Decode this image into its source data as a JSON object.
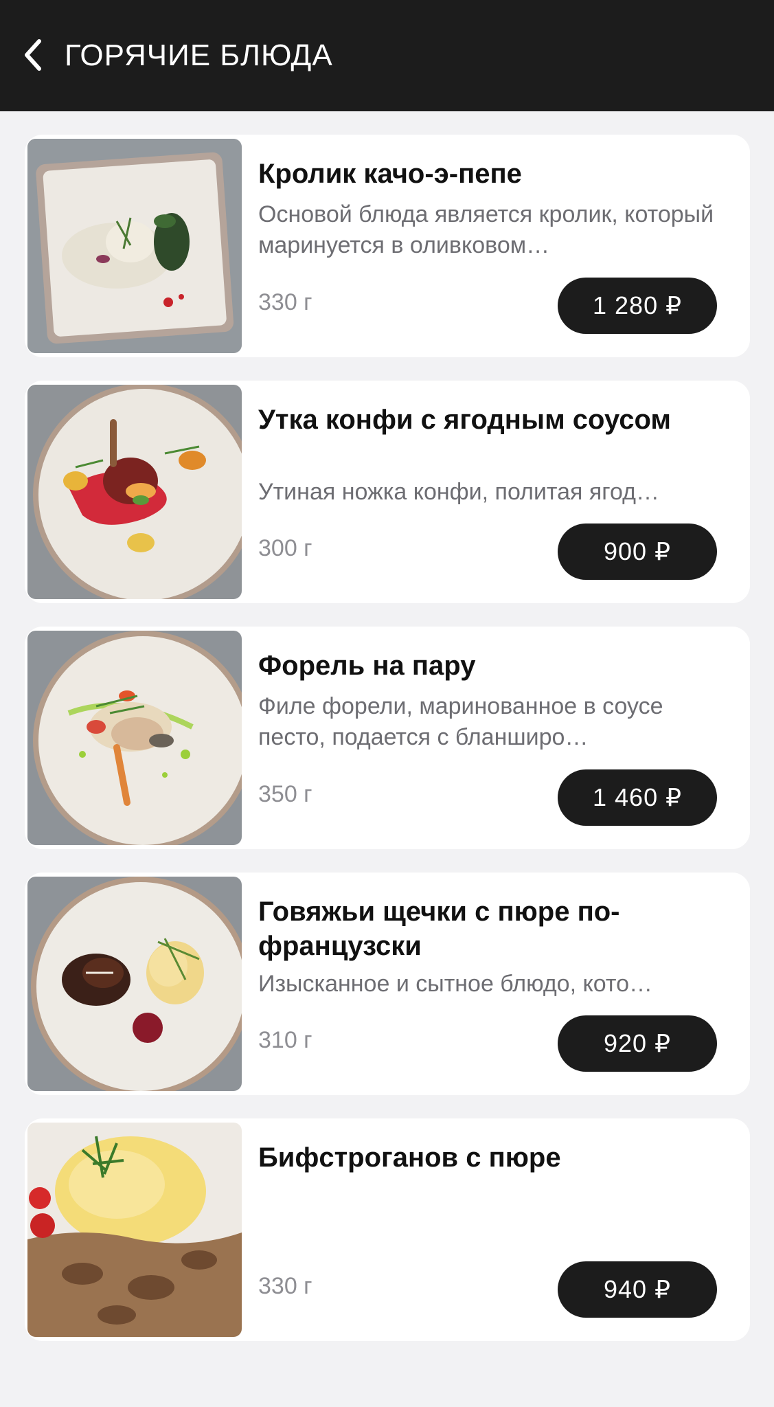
{
  "header": {
    "title": "ГОРЯЧИЕ БЛЮДА",
    "back_icon": "chevron-left-icon"
  },
  "colors": {
    "header_bg": "#1c1c1c",
    "page_bg": "#f2f2f4",
    "card_bg": "#ffffff",
    "price_bg": "#1c1c1c",
    "text_primary": "#111111",
    "text_secondary": "#6d6d72"
  },
  "items": [
    {
      "title": "Кролик качо-э-пепе",
      "description": "Основой блюда является кролик, который маринуется в оливковом…",
      "weight": "330 г",
      "price": "1 280 ₽",
      "image": "rabbit-dish-photo"
    },
    {
      "title": "Утка конфи с ягодным соусом",
      "description": "Утиная ножка конфи, политая ягод…",
      "weight": "300 г",
      "price": "900 ₽",
      "image": "duck-dish-photo"
    },
    {
      "title": "Форель на пару",
      "description": "Филе форели, маринованное в соусе песто, подается с бланширо…",
      "weight": "350 г",
      "price": "1 460 ₽",
      "image": "trout-dish-photo"
    },
    {
      "title": "Говяжьи щечки с пюре по-французски",
      "description": "Изысканное и сытное блюдо, кото…",
      "weight": "310 г",
      "price": "920 ₽",
      "image": "beef-cheeks-dish-photo"
    },
    {
      "title": "Бифстроганов с пюре",
      "description": "",
      "weight": "330 г",
      "price": "940 ₽",
      "image": "beef-stroganoff-dish-photo"
    }
  ]
}
